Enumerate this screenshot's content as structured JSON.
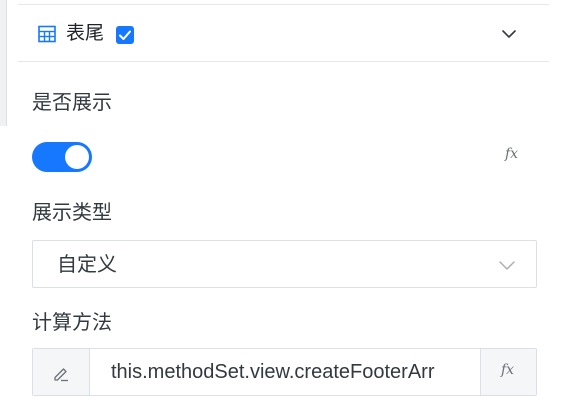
{
  "panel": {
    "title": "表尾",
    "checked": true,
    "icons": {
      "leading": "table-icon",
      "check": "check-icon",
      "toggle": "chevron-down-icon"
    }
  },
  "fields": {
    "show": {
      "label": "是否展示",
      "enabled": true,
      "expression_button": "fx"
    },
    "display_type": {
      "label": "展示类型",
      "value": "自定义",
      "icon": "chevron-down-icon"
    },
    "calc_method": {
      "label": "计算方法",
      "value": "this.methodSet.view.createFooterArr",
      "left_icon": "edit-icon",
      "expression_button": "fx"
    }
  },
  "colors": {
    "accent": "#1677ff",
    "border": "#dcdfe6",
    "addon_bg": "#f5f6f7",
    "text": "#333940"
  }
}
